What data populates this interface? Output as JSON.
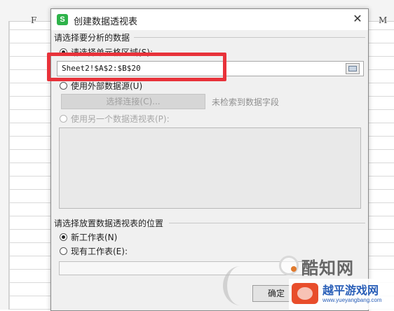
{
  "spreadsheet": {
    "col_f": "F",
    "col_m": "M"
  },
  "dialog": {
    "title": "创建数据透视表",
    "app_icon_letter": "S",
    "close_glyph": "✕",
    "data_section_label": "请选择要分析的数据",
    "option_cell_range": "请选择单元格区域(S):",
    "range_value": "Sheet2!$A$2:$B$20",
    "option_external": "使用外部数据源(U)",
    "select_connection_button": "选择连接(C)...",
    "no_fields_text": "未检索到数据字段",
    "option_other_pivot": "使用另一个数据透视表(P):",
    "location_section_label": "请选择放置数据透视表的位置",
    "option_new_sheet": "新工作表(N)",
    "option_existing_sheet": "现有工作表(E):",
    "ok_button": "确定"
  },
  "watermarks": {
    "brand1": "酷知网",
    "brand2": "越平游戏网",
    "brand2_url": "www.yueyangbang.com"
  },
  "colors": {
    "highlight": "#e8323a",
    "app_icon": "#2eb34a"
  }
}
